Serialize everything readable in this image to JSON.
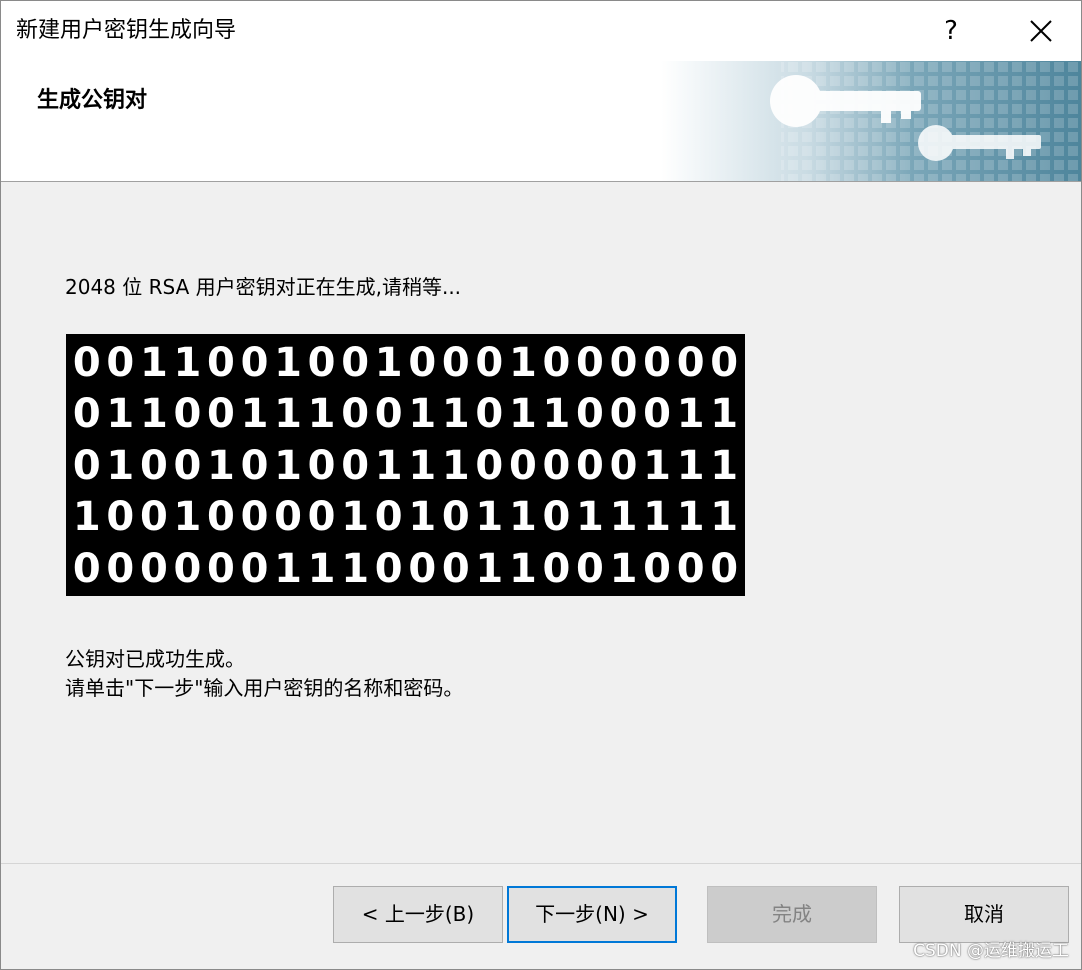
{
  "window": {
    "title": "新建用户密钥生成向导",
    "help_label": "?",
    "close_label": "✕"
  },
  "header": {
    "title": "生成公钥对"
  },
  "content": {
    "status": "2048 位 RSA 用户密钥对正在生成,请稍等...",
    "binary_rows": [
      "00110010010001000000",
      "01100111001101100011",
      "01001010011100000111",
      "10010000101011011111",
      "00000011100011001000"
    ],
    "done_line1": "公钥对已成功生成。",
    "done_line2": "请单击\"下一步\"输入用户密钥的名称和密码。"
  },
  "buttons": {
    "back": "< 上一步(B)",
    "next": "下一步(N) >",
    "finish": "完成",
    "cancel": "取消"
  },
  "watermark": "CSDN @运维搬运工",
  "colors": {
    "accent": "#0078d7",
    "banner": "#5a8fa6"
  }
}
